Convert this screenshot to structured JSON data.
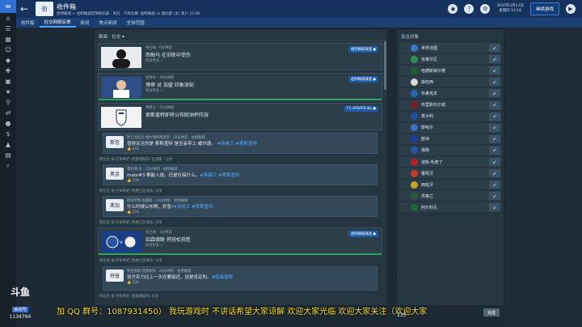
{
  "header": {
    "title": "收件箱",
    "subtitle": "伯明翰城 > 伯明翰城足球俱乐部 · 英冠 · 下周比赛: 伯明翰城 vs 德比郡 (主) 周六 15:00",
    "logo": "伯",
    "date": "2020年4月23日",
    "day": "星期四 14:16",
    "continue_label": "继续游戏"
  },
  "tabs": [
    "收件箱",
    "社交网络反馈",
    "新闻",
    "焦点新闻",
    "全球范围"
  ],
  "feed": {
    "header": "新闻 · 社交 ▾",
    "cards": [
      {
        "date": "布兰福 · 6分钟前",
        "text": "西梅乌 在训练中受伤",
        "sub": "阅读更多 »",
        "badge": "伯明翰城球迷 ●"
      },
      {
        "date": "迪特尔 · 10分钟前",
        "text": "博蒂 对 加盟 印象深刻",
        "sub": "阅读更多 »",
        "badge": "伯明翰城球迷 ●"
      },
      {
        "date": "英格兰 · 13分钟前",
        "text": "索斯盖特即将公布欧洲杯阵容",
        "sub": "阅读更多 »",
        "badge": "FC UPDATE.NL ●"
      },
      {
        "date": "布兰福 · 1小时前",
        "text": "绍森德联 将轻松获胜",
        "sub": "阅读更多 »",
        "badge": "伯明翰城球迷 ●"
      }
    ],
    "replies": [
      {
        "logo": "斯信",
        "date": "斯吉戈尼克·维尔德斯蒂奥罗 · 10分钟前 · 伯明翰城",
        "text": "值得关注的是 索斯盖特 是否会带上 威尔逊。 ",
        "tags": "#英格兰 #索斯盖特",
        "likes": "👍 433"
      },
      {
        "logo": "奥金",
        "date": "奥利弗·金 · 12分钟前 · 伯明翰城",
        "text": "mate#3 都能入选，还是在搞什么。",
        "tags": "#英格兰 #索斯盖特",
        "likes": "👍 178"
      },
      {
        "logo": "弗加",
        "date": "弗洛伦特·加鲁斯 · 14分钟前 · 伯明翰城",
        "text": "什么时候公布啊，好急!",
        "tags": "#英格兰 #索斯盖特",
        "likes": "👍 216"
      },
      {
        "logo": "特普",
        "date": "特拉维斯·普雷斯科 · 20分钟前 · 伯明翰城",
        "text": "双方实力比上一次还要接近，这是肯定的。",
        "tags": "#绍森德联",
        "likes": "👍 126"
      }
    ],
    "notes": [
      "阿比尼·肯·巴布特诺 (绍森德联阵) 伍迪斯 - 分享",
      "阿比尼·肯·巴布特诺 (英格兰足球队) 分享",
      "阿比尼·肯·巴布特诺 (英格兰足球队) 分享",
      "阿比尼·肯·巴布特诺 (英格兰足球队) 分享",
      "阿比尼·肯·巴布特诺 (绍森德联阵) 分享"
    ]
  },
  "follow": {
    "header": "关注对象",
    "items": [
      "世界范围",
      "克莱尔区",
      "哈德斯菲尔德",
      "斯旺西",
      "布莱克本",
      "布里斯托尔城",
      "意大利",
      "斯哈尔",
      "欧洲",
      "瑞典",
      "波斯·毛奇了",
      "葡萄牙",
      "西班牙",
      "苏格兰",
      "阿尔科孔"
    ],
    "colors": [
      "#3b79c6",
      "#2f8f4e",
      "#1d5f2d",
      "#d9d9d9",
      "#2b65b0",
      "#7b1d1d",
      "#1f4fa8",
      "#3a6fc2",
      "#1d3f9b",
      "#2456a3",
      "#b52020",
      "#c7372d",
      "#c8a128",
      "#2a5a36",
      "#1a6b2a"
    ]
  },
  "overlay": {
    "brand": "斗鱼",
    "brand_sub": "房间号",
    "room": "1134764",
    "ticker": "加 QQ 群号：1087931450） 我玩游戏时 不讲话希望大家谅解 欢迎大家光临 欢迎大家关注（欢迎大家",
    "counter": "135",
    "done_label": "完成"
  }
}
